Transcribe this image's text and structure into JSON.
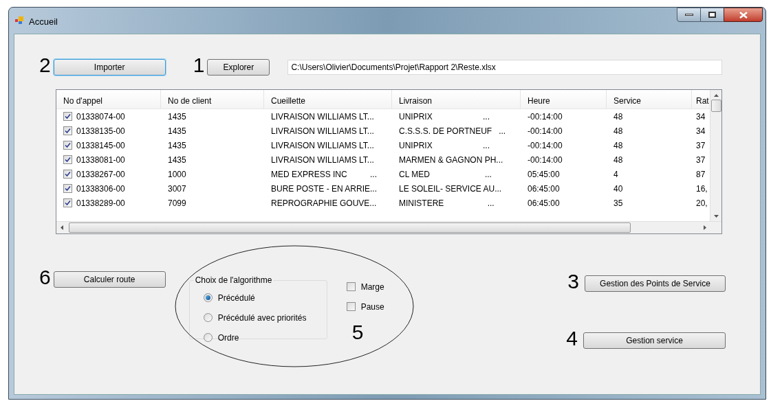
{
  "window": {
    "title": "Accueil"
  },
  "top": {
    "import_marker": "2",
    "import_button": "Importer",
    "explore_marker": "1",
    "explore_button": "Explorer",
    "path_field": "C:\\Users\\Olivier\\Documents\\Projet\\Rapport 2\\Reste.xlsx"
  },
  "table": {
    "columns": [
      "No d'appel",
      "No de client",
      "Cueillette",
      "Livraison",
      "Heure",
      "Service",
      "Rat"
    ],
    "rows": [
      {
        "checked": true,
        "cells": [
          "01338074-00",
          "1435",
          "LIVRAISON WILLIAMS LT...",
          "UNIPRIX                      ...",
          "-00:14:00",
          "48",
          "34"
        ]
      },
      {
        "checked": true,
        "cells": [
          "01338135-00",
          "1435",
          "LIVRAISON WILLIAMS LT...",
          "C.S.S.S. DE PORTNEUF   ...",
          "-00:14:00",
          "48",
          "34"
        ]
      },
      {
        "checked": true,
        "cells": [
          "01338145-00",
          "1435",
          "LIVRAISON WILLIAMS LT...",
          "UNIPRIX                      ...",
          "-00:14:00",
          "48",
          "37"
        ]
      },
      {
        "checked": true,
        "cells": [
          "01338081-00",
          "1435",
          "LIVRAISON WILLIAMS LT...",
          "MARMEN & GAGNON PH...",
          "-00:14:00",
          "48",
          "37"
        ]
      },
      {
        "checked": true,
        "cells": [
          "01338267-00",
          "1000",
          "MED EXPRESS INC          ...",
          "CL MED                        ...",
          "05:45:00",
          "4",
          "87"
        ]
      },
      {
        "checked": true,
        "cells": [
          "01338306-00",
          "3007",
          "BURE POSTE - EN ARRIE...",
          "LE SOLEIL- SERVICE AU...",
          "06:45:00",
          "40",
          "16,"
        ]
      },
      {
        "checked": true,
        "cells": [
          "01338289-00",
          "7099",
          "REPROGRAPHIE GOUVE...",
          "MINISTERE                   ...",
          "06:45:00",
          "35",
          "20,"
        ]
      }
    ]
  },
  "calc": {
    "marker": "6",
    "button": "Calculer route"
  },
  "algorithm": {
    "title": "Choix de l'algorithme",
    "options": [
      {
        "label": "Précédulé",
        "selected": true
      },
      {
        "label": "Précédulé avec priorités",
        "selected": false
      },
      {
        "label": "Ordre",
        "selected": false
      }
    ]
  },
  "options": [
    {
      "label": "Marge",
      "checked": false
    },
    {
      "label": "Pause",
      "checked": false
    }
  ],
  "options_marker": "5",
  "service_points": {
    "marker": "3",
    "button": "Gestion des Points de Service"
  },
  "service": {
    "marker": "4",
    "button": "Gestion service"
  }
}
